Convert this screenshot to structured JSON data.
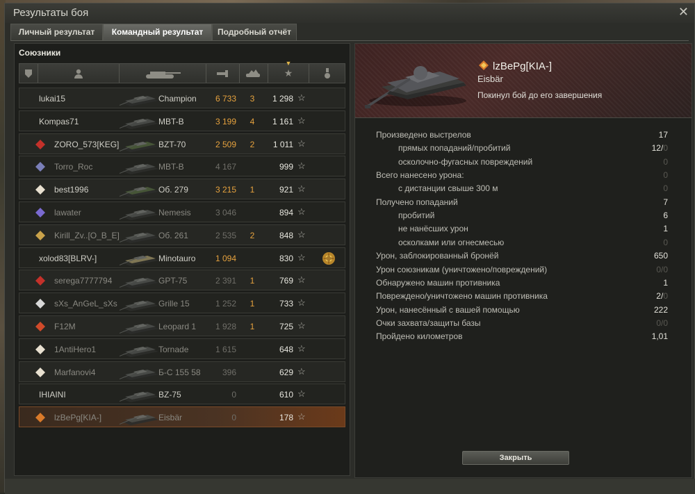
{
  "window": {
    "title": "Результаты боя"
  },
  "tabs": [
    {
      "label": "Личный результат"
    },
    {
      "label": "Командный результат"
    },
    {
      "label": "Подробный отчёт"
    }
  ],
  "team": {
    "heading": "Союзники",
    "columns": [
      "shield-icon",
      "player-icon",
      "tank-icon",
      "damage-icon",
      "kills-icon",
      "star-icon",
      "medal-icon"
    ],
    "rows": [
      {
        "player": "lukai15",
        "tank": "Champion",
        "damage": "6 733",
        "kills": "3",
        "xp": "1 298"
      },
      {
        "player": "Kompas71",
        "tank": "MBT-B",
        "damage": "3 199",
        "kills": "4",
        "xp": "1 161"
      },
      {
        "player": "ZORO_573[KEG]",
        "tank": "BZT-70",
        "damage": "2 509",
        "kills": "2",
        "xp": "1 011"
      },
      {
        "player": "Torro_Roc",
        "tank": "MBT-B",
        "damage": "4 167",
        "kills": "",
        "xp": "999"
      },
      {
        "player": "best1996",
        "tank": "Об. 279",
        "damage": "3 215",
        "kills": "1",
        "xp": "921"
      },
      {
        "player": "lawater",
        "tank": "Nemesis",
        "damage": "3 046",
        "kills": "",
        "xp": "894"
      },
      {
        "player": "Kirill_Zv..[O_B_E]",
        "tank": "Об. 261",
        "damage": "2 535",
        "kills": "2",
        "xp": "848"
      },
      {
        "player": "xolod83[BLRV-]",
        "tank": "Minotauro",
        "damage": "1 094",
        "kills": "",
        "xp": "830"
      },
      {
        "player": "serega7777794",
        "tank": "GPT-75",
        "damage": "2 391",
        "kills": "1",
        "xp": "769"
      },
      {
        "player": "sXs_AnGeL_sXs",
        "tank": "Grille 15",
        "damage": "1 252",
        "kills": "1",
        "xp": "733"
      },
      {
        "player": "F12M",
        "tank": "Leopard 1",
        "damage": "1 928",
        "kills": "1",
        "xp": "725"
      },
      {
        "player": "1AntiHero1",
        "tank": "Tornade",
        "damage": "1 615",
        "kills": "",
        "xp": "648"
      },
      {
        "player": "Marfanovi4",
        "tank": "Б-С 155 58",
        "damage": "396",
        "kills": "",
        "xp": "629"
      },
      {
        "player": "IHIAINI",
        "tank": "BZ-75",
        "damage": "0",
        "kills": "",
        "xp": "610"
      },
      {
        "player": "lzBePg[KIA-]",
        "tank": "Eisbär",
        "damage": "0",
        "kills": "",
        "xp": "178"
      }
    ],
    "star_glyph": "☆"
  },
  "detail": {
    "player": "lzBePg[KIA-]",
    "tank": "Eisbär",
    "status": "Покинул бой до его завершения",
    "stats": [
      {
        "label": "Произведено выстрелов",
        "value": "17"
      },
      {
        "label": "прямых попаданий/пробитий",
        "value": "12/",
        "value_dim": "0"
      },
      {
        "label": "осколочно-фугасных повреждений",
        "value": "",
        "value_dim": "0"
      },
      {
        "label": "Всего нанесено урона:",
        "value": "",
        "value_dim": "0"
      },
      {
        "label": "с дистанции свыше 300 м",
        "value": "",
        "value_dim": "0"
      },
      {
        "label": "Получено попаданий",
        "value": "7"
      },
      {
        "label": "пробитий",
        "value": "6"
      },
      {
        "label": "не нанёсших урон",
        "value": "1"
      },
      {
        "label": "осколками или огнесмесью",
        "value": "",
        "value_dim": "0"
      },
      {
        "label": "Урон, заблокированный бронёй",
        "value": "650"
      },
      {
        "label": "Урон союзникам (уничтожено/повреждений)",
        "value": "",
        "value_dim": "0/0"
      },
      {
        "label": "Обнаружено машин противника",
        "value": "1"
      },
      {
        "label": "Повреждено/уничтожено машин противника",
        "value": "2/",
        "value_dim": "0"
      },
      {
        "label": "Урон, нанесённый с вашей помощью",
        "value": "222"
      },
      {
        "label": "Очки захвата/защиты базы",
        "value": "",
        "value_dim": "0/0"
      },
      {
        "label": "Пройдено километров",
        "value": "1,01"
      }
    ],
    "close_label": "Закрыть"
  },
  "colors": {
    "accent": "#e6a23e",
    "self_row": "#6b3a1a"
  }
}
